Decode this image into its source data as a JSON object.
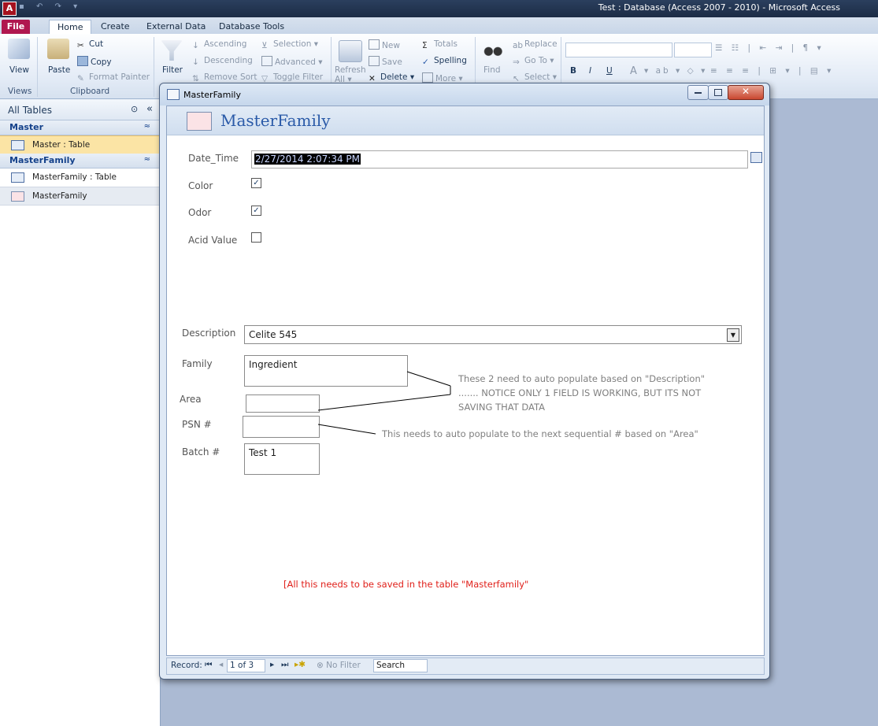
{
  "window": {
    "title": "Test : Database (Access 2007 - 2010)  -  Microsoft Access",
    "app_icon": "A"
  },
  "tabs": [
    "File",
    "Home",
    "Create",
    "External Data",
    "Database Tools"
  ],
  "ribbon": {
    "views": {
      "view": "View",
      "group": "Views"
    },
    "clipboard": {
      "paste": "Paste",
      "cut": "Cut",
      "copy": "Copy",
      "format_painter": "Format Painter",
      "group": "Clipboard"
    },
    "sort_filter": {
      "filter": "Filter",
      "ascending": "Ascending",
      "descending": "Descending",
      "remove_sort": "Remove Sort",
      "selection": "Selection",
      "advanced": "Advanced",
      "toggle_filter": "Toggle Filter"
    },
    "records": {
      "refresh": "Refresh",
      "refresh_all": "All",
      "new": "New",
      "save": "Save",
      "delete": "Delete",
      "totals": "Totals",
      "spelling": "Spelling",
      "more": "More"
    },
    "find": {
      "find": "Find",
      "replace": "Replace",
      "go_to": "Go To",
      "select": "Select"
    },
    "text_formatting": {
      "bold": "B",
      "italic": "I",
      "underline": "U",
      "font_color": "A"
    }
  },
  "nav": {
    "header": "All Tables",
    "groups": [
      {
        "name": "Master",
        "items": [
          {
            "label": "Master : Table",
            "selected": true
          }
        ]
      },
      {
        "name": "MasterFamily",
        "items": [
          {
            "label": "MasterFamily : Table",
            "selected": false
          },
          {
            "label": "MasterFamily",
            "selected": false
          }
        ]
      }
    ]
  },
  "form": {
    "window_title": "MasterFamily",
    "header_title": "MasterFamily",
    "fields": {
      "date_time": {
        "label": "Date_Time",
        "value": "2/27/2014 2:07:34 PM"
      },
      "color": {
        "label": "Color",
        "checked": true
      },
      "odor": {
        "label": "Odor",
        "checked": true
      },
      "acid_value": {
        "label": "Acid Value",
        "checked": false
      },
      "description": {
        "label": "Description",
        "value": "Celite 545"
      },
      "family": {
        "label": "Family",
        "value": "Ingredient"
      },
      "area": {
        "label": "Area",
        "value": ""
      },
      "psn": {
        "label": "PSN #",
        "value": ""
      },
      "batch": {
        "label": "Batch #",
        "value": "Test 1"
      }
    },
    "notes": {
      "autopopulate_1": "These 2 need to auto populate based on \"Description\"",
      "autopopulate_2": "....... NOTICE ONLY 1 FIELD IS WORKING, BUT ITS NOT",
      "autopopulate_3": "SAVING THAT DATA",
      "psn_note": "This needs to auto populate to the next sequential # based on \"Area\"",
      "save_note": "[All this needs to be saved in the table \"Masterfamily\""
    },
    "record_nav": {
      "label": "Record:",
      "position": "1 of 3",
      "filter": "No Filter",
      "search": "Search"
    }
  },
  "colors": {
    "accent": "#2a5aa8",
    "file_tab": "#b0174f",
    "note_red": "#e0201a"
  }
}
